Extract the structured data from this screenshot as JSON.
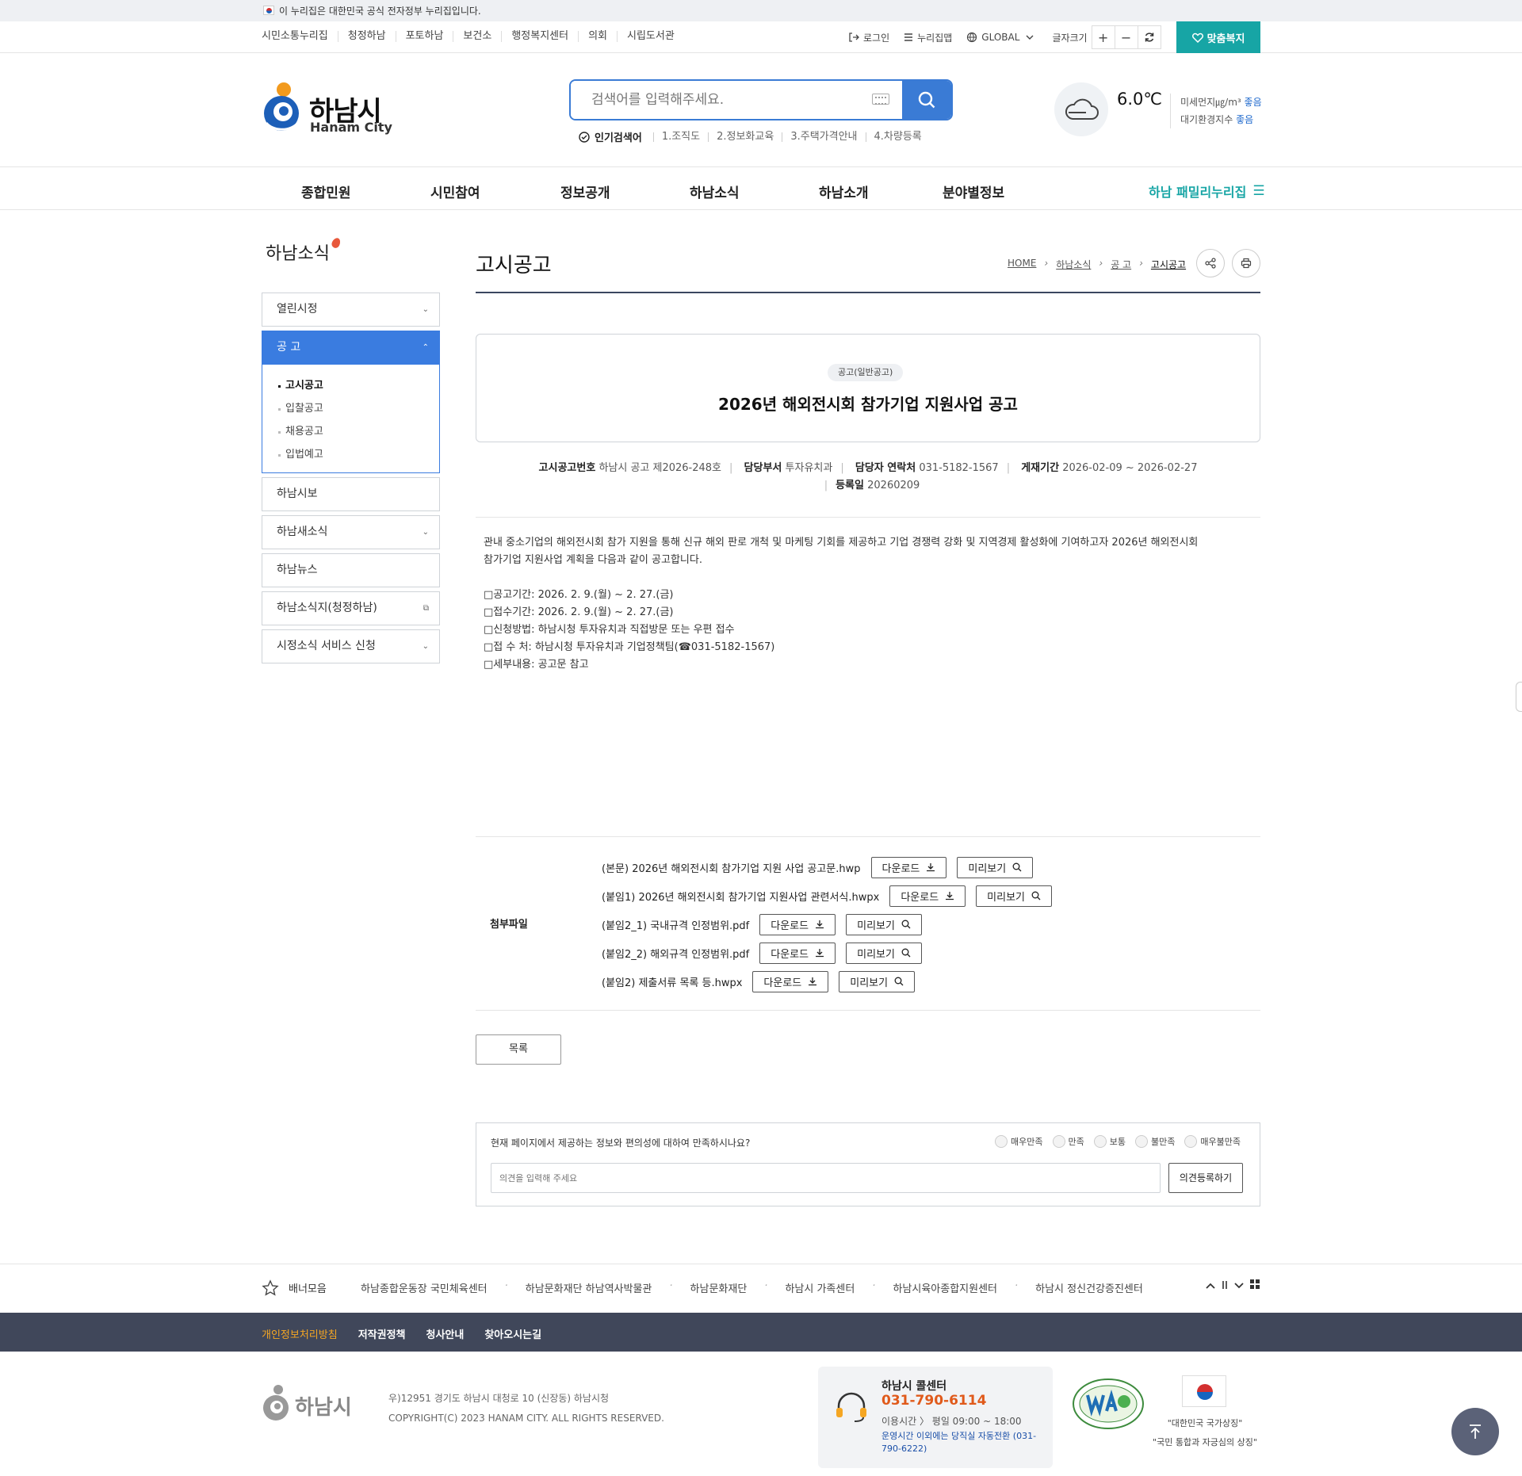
{
  "gov_banner": {
    "text": "이 누리집은 대한민국 공식 전자정부 누리집입니다."
  },
  "util": {
    "links": [
      "시민소통누리집",
      "청정하남",
      "포토하남",
      "보건소",
      "행정복지센터",
      "의회",
      "시립도서관"
    ],
    "login": "로그인",
    "sitemap": "누리집맵",
    "global": "GLOBAL",
    "font_size_label": "글자크기",
    "font_plus": "+",
    "font_minus": "−",
    "custom_welfare": "맞춤복지"
  },
  "header": {
    "logo_name": "하남시",
    "logo_sub": "Hanam City",
    "search_placeholder": "검색어를 입력해주세요.",
    "popular_label": "인기검색어",
    "popular_keywords": [
      "1.조직도",
      "2.정보화교육",
      "3.주택가격안내",
      "4.차량등록"
    ],
    "temperature": "6.0℃",
    "fine_dust_label": "미세먼지㎍/m³",
    "fine_dust_value": "좋음",
    "air_index_label": "대기환경지수",
    "air_index_value": "좋음"
  },
  "gnb": {
    "menus": [
      "종합민원",
      "시민참여",
      "정보공개",
      "하남소식",
      "하남소개",
      "분야별정보"
    ],
    "family": "하남 패밀리누리집"
  },
  "lnb": {
    "title": "하남소식",
    "items": [
      "열린시정",
      "공 고",
      "하남시보",
      "하남새소식",
      "하남뉴스",
      "하남소식지(청정하남)",
      "시정소식 서비스 신청"
    ],
    "sub_items": [
      "고시공고",
      "입찰공고",
      "채용공고",
      "입법예고"
    ]
  },
  "content": {
    "page_title": "고시공고",
    "breadcrumb": [
      "HOME",
      "하남소식",
      "공 고",
      "고시공고"
    ],
    "badge": "공고(일반공고)",
    "notice_title": "2026년 해외전시회 참가기업 지원사업 공고",
    "meta": {
      "no_label": "고시공고번호",
      "no_value": "하남시 공고 제2026-248호",
      "dept_label": "담당부서",
      "dept_value": "투자유치과",
      "tel_label": "담당자 연락처",
      "tel_value": "031-5182-1567",
      "period_label": "게재기간",
      "period_value": "2026-02-09 ~ 2026-02-27",
      "reg_label": "등록일",
      "reg_value": "20260209"
    },
    "body": [
      "관내 중소기업의 해외전시회 참가 지원을 통해 신규 해외 판로 개척 및 마케팅 기회를 제공하고 기업 경쟁력 강화 및 지역경제 활성화에 기여하고자 2026년 해외전시회",
      "참가기업 지원사업 계획을 다음과 같이 공고합니다.",
      "",
      "□공고기간: 2026. 2. 9.(월) ~ 2. 27.(금)",
      "□접수기간: 2026. 2. 9.(월) ~ 2. 27.(금)",
      "□신청방법: 하남시청 투자유치과 직접방문 또는 우편 접수",
      "□접 수 처: 하남시청 투자유치과 기업정책팀(☎031-5182-1567)",
      "□세부내용: 공고문 참고"
    ],
    "attach_label": "첨부파일",
    "files": [
      "(본문) 2026년 해외전시회 참가기업 지원 사업 공고문.hwp",
      "(붙임1) 2026년 해외전시회 참가기업 지원사업 관련서식.hwpx",
      "(붙임2_1) 국내규격 인정범위.pdf",
      "(붙임2_2) 해외규격 인정범위.pdf",
      "(붙임2) 제출서류 목록 등.hwpx"
    ],
    "download_label": "다운로드",
    "preview_label": "미리보기",
    "list_button": "목록"
  },
  "survey": {
    "question": "현재 페이지에서 제공하는 정보와 편의성에 대하여 만족하시나요?",
    "options": [
      "매우만족",
      "만족",
      "보통",
      "불만족",
      "매우불만족"
    ],
    "placeholder": "의견을 입력해 주세요",
    "submit": "의견등록하기"
  },
  "banner": {
    "label": "배너모음",
    "items": [
      "하남종합운동장 국민체육센터",
      "하남문화재단 하남역사박물관",
      "하남문화재단",
      "하남시 가족센터",
      "하남시육아종합지원센터",
      "하남시 정신건강증진센터"
    ]
  },
  "footer": {
    "nav": [
      "개인정보처리방침",
      "저작권정책",
      "청사안내",
      "찾아오시는길"
    ],
    "logo": "하남시",
    "address": "우)12951 경기도 하남시 대청로 10 (신장동) 하남시청",
    "copyright": "COPYRIGHT(C) 2023 HANAM CITY. ALL RIGHTS RESERVED.",
    "call_title": "하남시 콜센터",
    "call_number": "031-790-6114",
    "call_hours": "이용시간 〉 평일 09:00 ~ 18:00",
    "call_note": "운영시간 이외에는 당직실 자동전환 (031-790-6222)",
    "national_symbol_1": "\"대한민국 국가상징\"",
    "national_symbol_2": "\"국민 통합과 자긍심의 상징\""
  },
  "colors": {
    "accent": "#3a7ce0",
    "teal": "#17a5a5",
    "footer": "#40475a",
    "call": "#e05a1b"
  }
}
